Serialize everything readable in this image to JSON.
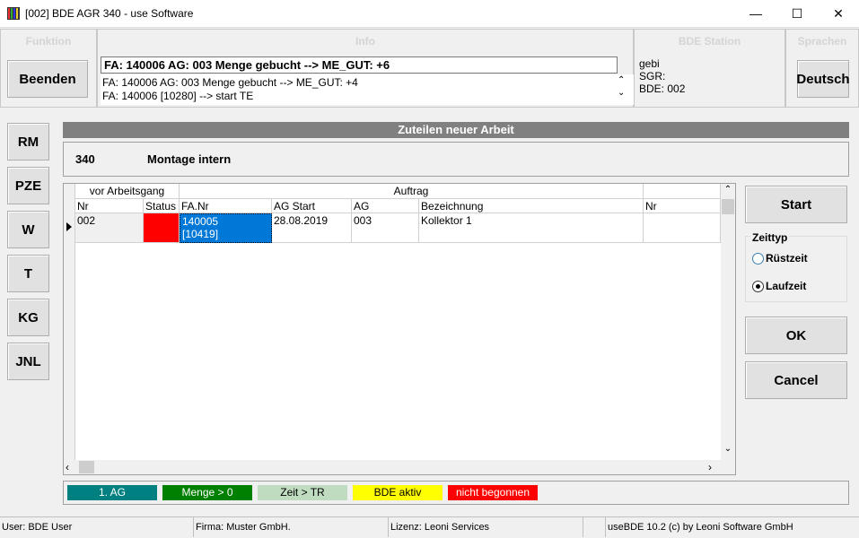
{
  "window": {
    "title": "[002] BDE AGR 340 - use Software",
    "minimize": "—",
    "maximize": "☐",
    "close": "✕"
  },
  "groups": {
    "funktion": "Funktion",
    "info": "Info",
    "bde_station": "BDE Station",
    "sprachen": "Sprachen"
  },
  "buttons": {
    "beenden": "Beenden",
    "deutsch": "Deutsch",
    "start": "Start",
    "ok": "OK",
    "cancel": "Cancel"
  },
  "info": {
    "current": "FA: 140006 AG: 003 Menge gebucht --> ME_GUT: +6",
    "log": [
      "FA: 140006 AG: 003 Menge gebucht --> ME_GUT: +4",
      "FA: 140006 [10280] --> start TE"
    ]
  },
  "station": {
    "line1": "gebi",
    "line2": "SGR:",
    "line3": "BDE: 002"
  },
  "side_buttons": [
    "RM",
    "PZE",
    "W",
    "T",
    "KG",
    "JNL"
  ],
  "section_title": "Zuteilen neuer Arbeit",
  "workstation": {
    "nr": "340",
    "name": "Montage intern"
  },
  "grid": {
    "group_headers": {
      "vor": "vor Arbeitsgang",
      "auftrag": "Auftrag"
    },
    "columns": [
      "Nr",
      "Status",
      "FA.Nr",
      "AG Start",
      "AG",
      "Bezeichnung",
      "Nr"
    ],
    "rows": [
      {
        "nr": "002",
        "status_color": "#ff0000",
        "fa_nr": "140005",
        "fa_sub": "[10419]",
        "ag_start": "28.08.2019",
        "ag": "003",
        "bezeichnung": "Kollektor 1",
        "nr2": ""
      }
    ]
  },
  "zeittyp": {
    "title": "Zeittyp",
    "options": [
      "Rüstzeit",
      "Laufzeit"
    ],
    "selected": "Laufzeit"
  },
  "legend": [
    {
      "label": "1. AG",
      "bg": "#008080",
      "fg": "#ffffff"
    },
    {
      "label": "Menge > 0",
      "bg": "#008000",
      "fg": "#ffffff"
    },
    {
      "label": "Zeit > TR",
      "bg": "#c0dcc0",
      "fg": "#000000"
    },
    {
      "label": "BDE aktiv",
      "bg": "#ffff00",
      "fg": "#000000"
    },
    {
      "label": "nicht begonnen",
      "bg": "#ff0000",
      "fg": "#ffffff"
    }
  ],
  "status_bar": {
    "user": "User: BDE User",
    "firma": "Firma: Muster GmbH.",
    "lizenz": "Lizenz: Leoni Services",
    "version": "useBDE 10.2 (c) by Leoni Software GmbH"
  },
  "colors": {
    "group_header": "#d4d4d4",
    "section_bar": "#808080",
    "selected_cell": "#0078d7"
  }
}
